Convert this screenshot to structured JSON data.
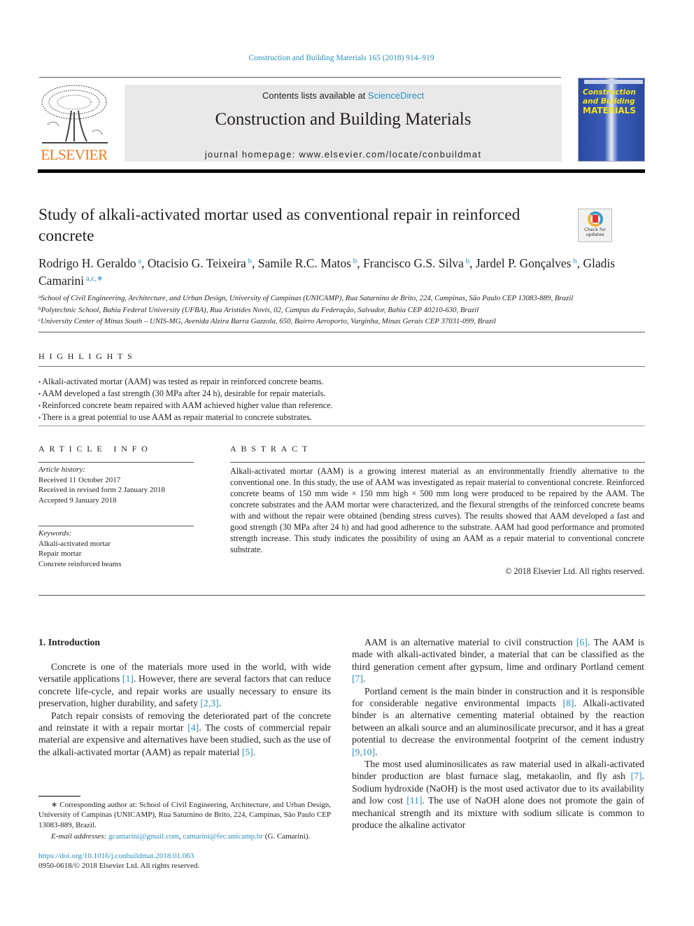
{
  "header": {
    "journal_reference": "Construction and Building Materials 165 (2018) 914–919",
    "publisher_logo_text": "ELSEVIER",
    "contents_prefix": "Contents lists available at ",
    "contents_link": "ScienceDirect",
    "journal_title": "Construction and Building Materials",
    "homepage": "journal homepage: www.elsevier.com/locate/conbuildmat",
    "cover": {
      "line1": "Construction",
      "line2": "and Building",
      "line3": "MATERIALS"
    },
    "check_updates_label": "Check for updates"
  },
  "article": {
    "title": "Study of alkali-activated mortar used as conventional repair in reinforced concrete",
    "authors": [
      {
        "name": "Rodrigo H. Geraldo",
        "aff": "a"
      },
      {
        "name": "Otacisio G. Teixeira",
        "aff": "b"
      },
      {
        "name": "Samile R.C. Matos",
        "aff": "b"
      },
      {
        "name": "Francisco G.S. Silva",
        "aff": "b"
      },
      {
        "name": "Jardel P. Gonçalves",
        "aff": "b"
      },
      {
        "name": "Gladis Camarini",
        "aff": "a,c,∗"
      }
    ],
    "affiliations": [
      {
        "key": "a",
        "text": "School of Civil Engineering, Architecture, and Urban Design, University of Campinas (UNICAMP), Rua Saturnino de Brito, 224, Campinas, São Paulo CEP 13083-889, Brazil"
      },
      {
        "key": "b",
        "text": "Polytechnic School, Bahia Federal University (UFBA), Rua Aristides Novis, 02, Campus da Federação, Salvador, Bahia CEP 40210-630, Brazil"
      },
      {
        "key": "c",
        "text": "University Center of Minas South – UNIS-MG, Avenida Alzira Barra Gazzola, 650, Bairro Aeroporto, Varginha, Minas Gerais CEP 37031-099, Brazil"
      }
    ]
  },
  "highlights": {
    "title": "HIGHLIGHTS",
    "items": [
      "Alkali-activated mortar (AAM) was tested as repair in reinforced concrete beams.",
      "AAM developed a fast strength (30 MPa after 24 h), desirable for repair materials.",
      "Reinforced concrete beam repaired with AAM achieved higher value than reference.",
      "There is a great potential to use AAM as repair material to concrete substrates."
    ]
  },
  "article_info": {
    "title": "ARTICLE INFO",
    "history_label": "Article history:",
    "history": [
      "Received 11 October 2017",
      "Received in revised form 2 January 2018",
      "Accepted 9 January 2018"
    ],
    "keywords_label": "Keywords:",
    "keywords": [
      "Alkali-activated mortar",
      "Repair mortar",
      "Concrete reinforced beams"
    ]
  },
  "abstract": {
    "title": "ABSTRACT",
    "text": "Alkali-activated mortar (AAM) is a growing interest material as an environmentally friendly alternative to the conventional one. In this study, the use of AAM was investigated as repair material to conventional concrete. Reinforced concrete beams of 150 mm wide × 150 mm high × 500 mm long were produced to be repaired by the AAM. The concrete substrates and the AAM mortar were characterized, and the flexural strengths of the reinforced concrete beams with and without the repair were obtained (bending stress curves). The results showed that AAM developed a fast and good strength (30 MPa after 24 h) and had good adherence to the substrate. AAM had good performance and promoted strength increase. This study indicates the possibility of using an AAM as a repair material to conventional concrete substrate.",
    "copyright": "© 2018 Elsevier Ltd. All rights reserved."
  },
  "body": {
    "section_heading": "1. Introduction",
    "left_paragraphs": [
      [
        {
          "t": "Concrete is one of the materials more used in the world, with wide versatile applications "
        },
        {
          "ref": "[1]"
        },
        {
          "t": ". However, there are several factors that can reduce concrete life-cycle, and repair works are usually necessary to ensure its preservation, higher durability, and safety "
        },
        {
          "ref": "[2,3]"
        },
        {
          "t": "."
        }
      ],
      [
        {
          "t": "Patch repair consists of removing the deteriorated part of the concrete and reinstate it with a repair mortar "
        },
        {
          "ref": "[4]"
        },
        {
          "t": ". The costs of commercial repair material are expensive and alternatives have been studied, such as the use of the alkali-activated mortar (AAM) as repair material "
        },
        {
          "ref": "[5]"
        },
        {
          "t": "."
        }
      ]
    ],
    "right_paragraphs": [
      [
        {
          "t": "AAM is an alternative material to civil construction "
        },
        {
          "ref": "[6]"
        },
        {
          "t": ". The AAM is made with alkali-activated binder, a material that can be classified as the third generation cement after gypsum, lime and ordinary Portland cement "
        },
        {
          "ref": "[7]"
        },
        {
          "t": "."
        }
      ],
      [
        {
          "t": "Portland cement is the main binder in construction and it is responsible for considerable negative environmental impacts "
        },
        {
          "ref": "[8]"
        },
        {
          "t": ". Alkali-activated binder is an alternative cementing material obtained by the reaction between an alkali source and an aluminosilicate precursor, and it has a great potential to decrease the environmental footprint of the cement industry "
        },
        {
          "ref": "[9,10]"
        },
        {
          "t": "."
        }
      ],
      [
        {
          "t": "The most used aluminosilicates as raw material used in alkali-activated binder production are blast furnace slag, metakaolin, and fly ash "
        },
        {
          "ref": "[7]"
        },
        {
          "t": ". Sodium hydroxide (NaOH) is the most used activator due to its availability and low cost "
        },
        {
          "ref": "[11]"
        },
        {
          "t": ". The use of NaOH alone does not promote the gain of mechanical strength and its mixture with sodium silicate is common to produce the alkaline activator"
        }
      ]
    ]
  },
  "footnote": {
    "corresponding": "∗ Corresponding author at: School of Civil Engineering, Architecture, and Urban Design, University of Campinas (UNICAMP), Rua Saturnino de Brito, 224, Campinas, São Paulo CEP 13083-889, Brazil.",
    "email_label": "E-mail addresses: ",
    "emails": [
      "gcamarini@gmail.com",
      "camarini@fec.unicamp.br"
    ],
    "email_owner": " (G. Camarini).",
    "doi": "https://doi.org/10.1016/j.conbuildmat.2018.01.063",
    "issn_line": "0950-0618/© 2018 Elsevier Ltd. All rights reserved."
  },
  "colors": {
    "link": "#2a8fbd",
    "elsevier_orange": "#f47a20",
    "banner_gray": "#e9e9e9",
    "cover_blue": "#2a4aa0",
    "cover_yellow": "#f6e21a"
  }
}
